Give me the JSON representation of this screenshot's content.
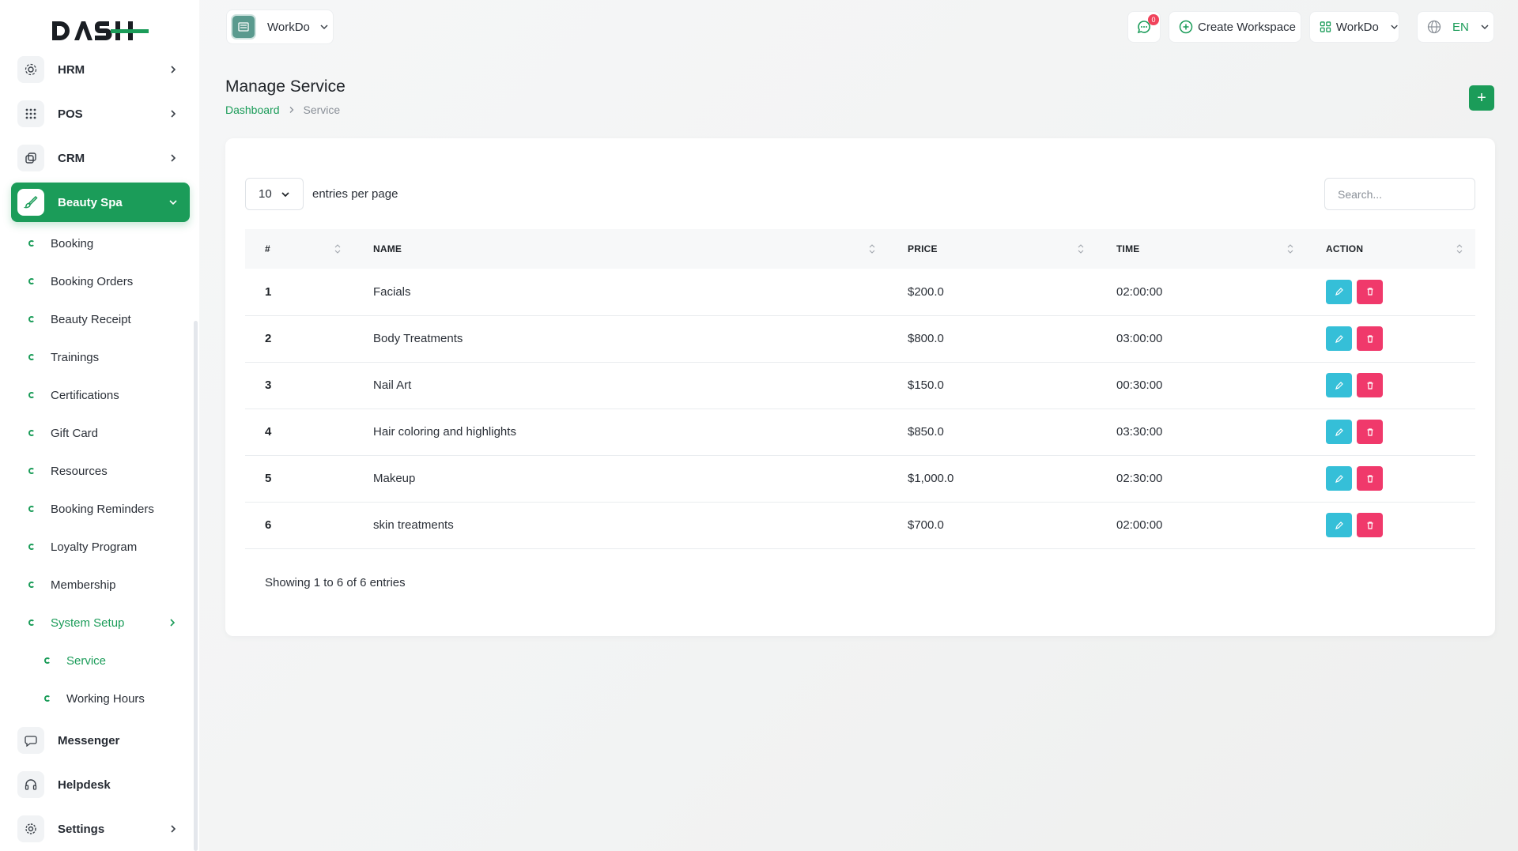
{
  "brand": {
    "logo_text": "DASH",
    "accent": "#1b9c59"
  },
  "sidebar": {
    "top_items": [
      {
        "label": "HRM",
        "icon": "hrm-icon"
      },
      {
        "label": "POS",
        "icon": "grid-icon"
      },
      {
        "label": "CRM",
        "icon": "crm-icon"
      }
    ],
    "active_item": {
      "label": "Beauty Spa",
      "icon": "brush-icon"
    },
    "sub_items": [
      "Booking",
      "Booking Orders",
      "Beauty Receipt",
      "Trainings",
      "Certifications",
      "Gift Card",
      "Resources",
      "Booking Reminders",
      "Loyalty Program",
      "Membership"
    ],
    "system_setup": {
      "label": "System Setup",
      "children": [
        "Service",
        "Working Hours"
      ]
    },
    "bottom_items": [
      {
        "label": "Messenger",
        "icon": "message-icon"
      },
      {
        "label": "Helpdesk",
        "icon": "headset-icon"
      },
      {
        "label": "Settings",
        "icon": "gear-icon"
      }
    ]
  },
  "topbar": {
    "workspace_name": "WorkDo",
    "notification_count": "0",
    "create_workspace": "Create Workspace",
    "workspace_switch": "WorkDo",
    "language": "EN"
  },
  "page": {
    "title": "Manage Service",
    "breadcrumb": {
      "home": "Dashboard",
      "current": "Service"
    },
    "add_label": "+"
  },
  "table": {
    "per_page": "10",
    "per_page_label": "entries per page",
    "search_placeholder": "Search...",
    "columns": [
      "#",
      "NAME",
      "PRICE",
      "TIME",
      "ACTION"
    ],
    "rows": [
      {
        "num": "1",
        "name": "Facials",
        "price": "$200.0",
        "time": "02:00:00"
      },
      {
        "num": "2",
        "name": "Body Treatments",
        "price": "$800.0",
        "time": "03:00:00"
      },
      {
        "num": "3",
        "name": "Nail Art",
        "price": "$150.0",
        "time": "00:30:00"
      },
      {
        "num": "4",
        "name": "Hair coloring and highlights",
        "price": "$850.0",
        "time": "03:30:00"
      },
      {
        "num": "5",
        "name": "Makeup",
        "price": "$1,000.0",
        "time": "02:30:00"
      },
      {
        "num": "6",
        "name": "skin treatments",
        "price": "$700.0",
        "time": "02:00:00"
      }
    ],
    "footer": "Showing 1 to 6 of 6 entries"
  }
}
